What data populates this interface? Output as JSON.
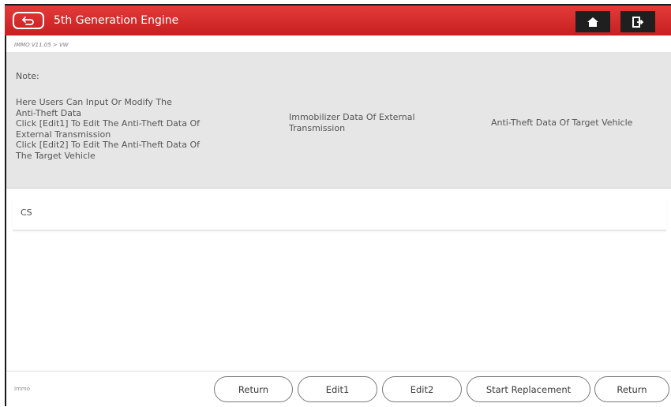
{
  "header": {
    "title": "5th Generation Engine",
    "back_icon": "back-arrow-icon",
    "home_icon": "home-icon",
    "exit_icon": "exit-icon",
    "brand_color": "#d42a2a"
  },
  "breadcrumb": "IMMO V11.05 > VW",
  "note": {
    "label": "Note:",
    "text": "Here Users Can Input Or Modify The\nAnti-Theft Data\nClick [Edit1] To Edit The Anti-Theft Data Of\nExternal Transmission\nClick [Edit2] To Edit The Anti-Theft Data Of\nThe Target Vehicle",
    "column2": "Immobilizer Data Of External\nTransmission",
    "column3": "Anti-Theft Data Of Target Vehicle"
  },
  "rows": [
    {
      "label": "CS"
    }
  ],
  "footer": {
    "label": "Immo",
    "buttons": [
      "Return",
      "Edit1",
      "Edit2",
      "Start Replacement",
      "Return"
    ]
  }
}
